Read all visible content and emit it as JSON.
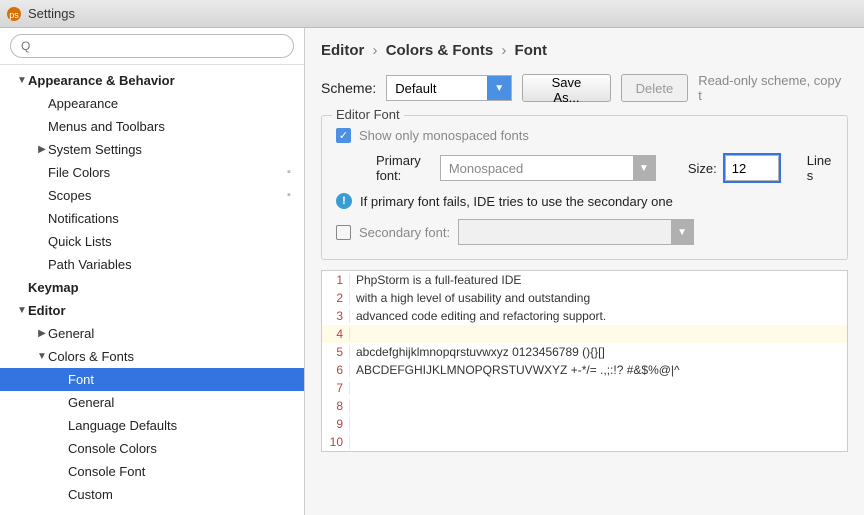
{
  "window": {
    "title": "Settings"
  },
  "search": {
    "placeholder": "Q"
  },
  "tree": {
    "appearance_behavior": "Appearance & Behavior",
    "appearance": "Appearance",
    "menus_toolbars": "Menus and Toolbars",
    "system_settings": "System Settings",
    "file_colors": "File Colors",
    "scopes": "Scopes",
    "notifications": "Notifications",
    "quick_lists": "Quick Lists",
    "path_variables": "Path Variables",
    "keymap": "Keymap",
    "editor": "Editor",
    "general": "General",
    "colors_fonts": "Colors & Fonts",
    "font": "Font",
    "general2": "General",
    "language_defaults": "Language Defaults",
    "console_colors": "Console Colors",
    "console_font": "Console Font",
    "custom": "Custom"
  },
  "breadcrumb": {
    "p1": "Editor",
    "p2": "Colors & Fonts",
    "p3": "Font"
  },
  "scheme": {
    "label": "Scheme:",
    "value": "Default",
    "save_as": "Save As...",
    "delete": "Delete",
    "note": "Read-only scheme, copy t"
  },
  "editor_font": {
    "legend": "Editor Font",
    "show_monospaced": "Show only monospaced fonts",
    "primary_label": "Primary font:",
    "primary_value": "Monospaced",
    "size_label": "Size:",
    "size_value": "12",
    "linespacing_label": "Line s",
    "info_text": "If primary font fails, IDE tries to use the secondary one",
    "secondary_label": "Secondary font:",
    "secondary_value": ""
  },
  "preview": {
    "l1": "PhpStorm is a full-featured IDE",
    "l2": "with a high level of usability and outstanding",
    "l3": "advanced code editing and refactoring support.",
    "l4": "",
    "l5": "abcdefghijklmnopqrstuvwxyz 0123456789 (){}[]",
    "l6": "ABCDEFGHIJKLMNOPQRSTUVWXYZ +-*/= .,;:!? #&$%@|^",
    "l7": "",
    "l8": "",
    "l9": "",
    "l10": ""
  }
}
